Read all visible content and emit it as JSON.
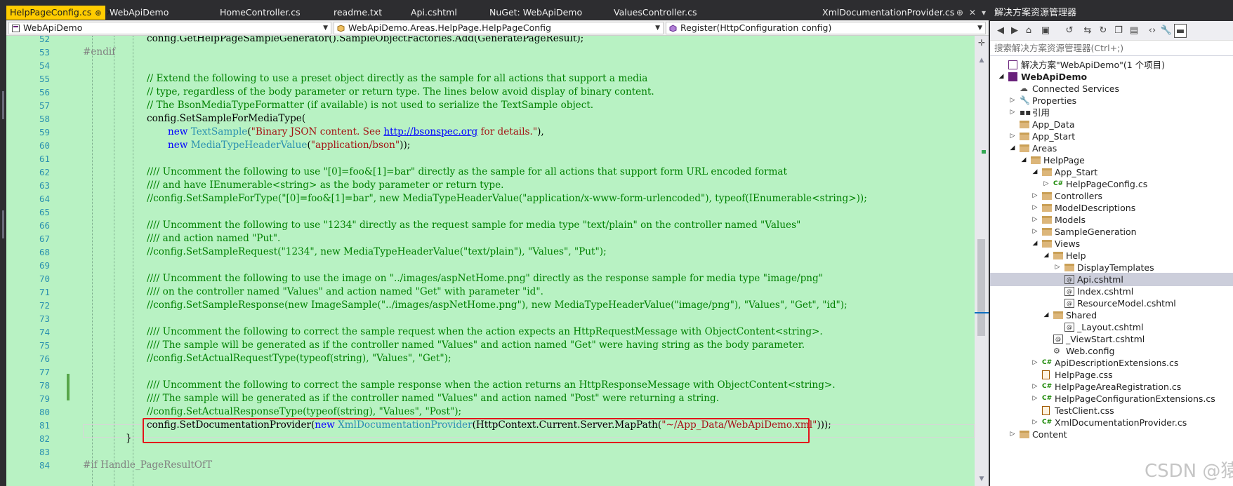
{
  "tabs": [
    {
      "label": "HelpPageConfig.cs",
      "active": true,
      "pin": "⊕",
      "close": "✕"
    },
    {
      "label": "WebApiDemo"
    },
    {
      "label": "HomeController.cs"
    },
    {
      "label": "readme.txt"
    },
    {
      "label": "Api.cshtml"
    },
    {
      "label": "NuGet: WebApiDemo"
    },
    {
      "label": "ValuesController.cs"
    },
    {
      "label": "XmlDocumentationProvider.cs"
    }
  ],
  "tab_bar_icons": {
    "pin": "⊕",
    "close": "✕",
    "menu": "▾"
  },
  "nav": {
    "project": "WebApiDemo",
    "type": "WebApiDemo.Areas.HelpPage.HelpPageConfig",
    "member": "Register(HttpConfiguration config)"
  },
  "line_numbers": [
    "52",
    "53",
    "54",
    "55",
    "56",
    "57",
    "58",
    "59",
    "60",
    "61",
    "62",
    "63",
    "64",
    "65",
    "66",
    "67",
    "68",
    "69",
    "70",
    "71",
    "72",
    "73",
    "74",
    "75",
    "76",
    "77",
    "78",
    "79",
    "80",
    "81",
    "82",
    "83",
    "84"
  ],
  "code": {
    "l52": "config.GetHelpPageSampleGenerator().SampleObjectFactories.Add(GeneratePageResult);",
    "l53": "#endif",
    "l55": "// Extend the following to use a preset object directly as the sample for all actions that support a media",
    "l56": "// type, regardless of the body parameter or return type. The lines below avoid display of binary content.",
    "l57": "// The BsonMediaTypeFormatter (if available) is not used to serialize the TextSample object.",
    "l58": "config.SetSampleForMediaType(",
    "l59_kw": "new",
    "l59_ty": "TextSample",
    "l59_p": "(",
    "l59_s1": "\"Binary JSON content. See ",
    "l59_link": "http://bsonspec.org",
    "l59_s2": " for details.\"",
    "l59_e": "),",
    "l60_kw": "new",
    "l60_ty": "MediaTypeHeaderValue",
    "l60_p": "(",
    "l60_s": "\"application/bson\"",
    "l60_e": "));",
    "l62": "//// Uncomment the following to use \"[0]=foo&[1]=bar\" directly as the sample for all actions that support form URL encoded format",
    "l63": "//// and have IEnumerable<string> as the body parameter or return type.",
    "l64": "//config.SetSampleForType(\"[0]=foo&[1]=bar\", new MediaTypeHeaderValue(\"application/x-www-form-urlencoded\"), typeof(IEnumerable<string>));",
    "l66": "//// Uncomment the following to use \"1234\" directly as the request sample for media type \"text/plain\" on the controller named \"Values\"",
    "l67": "//// and action named \"Put\".",
    "l68": "//config.SetSampleRequest(\"1234\", new MediaTypeHeaderValue(\"text/plain\"), \"Values\", \"Put\");",
    "l70": "//// Uncomment the following to use the image on \"../images/aspNetHome.png\" directly as the response sample for media type \"image/png\"",
    "l71": "//// on the controller named \"Values\" and action named \"Get\" with parameter \"id\".",
    "l72": "//config.SetSampleResponse(new ImageSample(\"../images/aspNetHome.png\"), new MediaTypeHeaderValue(\"image/png\"), \"Values\", \"Get\", \"id\");",
    "l74": "//// Uncomment the following to correct the sample request when the action expects an HttpRequestMessage with ObjectContent<string>.",
    "l75": "//// The sample will be generated as if the controller named \"Values\" and action named \"Get\" were having string as the body parameter.",
    "l76": "//config.SetActualRequestType(typeof(string), \"Values\", \"Get\");",
    "l78": "//// Uncomment the following to correct the sample response when the action returns an HttpResponseMessage with ObjectContent<string>.",
    "l79": "//// The sample will be generated as if the controller named \"Values\" and action named \"Post\" were returning a string.",
    "l80": "//config.SetActualResponseType(typeof(string), \"Values\", \"Post\");",
    "l81_a": "config.SetDocumentationProvider(",
    "l81_kw": "new",
    "l81_ty": "XmlDocumentationProvider",
    "l81_b": "(HttpContext.Current.Server.MapPath(",
    "l81_s": "\"~/App_Data/WebApiDemo.xml\"",
    "l81_e": ")));",
    "l82": "}",
    "l84": "#if Handle_PageResultOfT"
  },
  "solution_explorer": {
    "title": "解决方案资源管理器",
    "search_placeholder": "搜索解决方案资源管理器(Ctrl+;)",
    "toolbar_icons": [
      "◀",
      "▶",
      "⌂",
      "▣",
      "↺",
      "⇆",
      "↻",
      "❐",
      "▤",
      "‹›",
      "🔧",
      "▬"
    ],
    "nodes": [
      {
        "label": "解决方案\"WebApiDemo\"(1 个项目)",
        "icon": "sol",
        "expander": "",
        "level": 0
      },
      {
        "label": "WebApiDemo",
        "icon": "proj",
        "expander": "◢",
        "level": 0,
        "bold": true
      },
      {
        "label": "Connected Services",
        "icon": "gear",
        "expander": "",
        "level": 1
      },
      {
        "label": "Properties",
        "icon": "wrench",
        "expander": "▷",
        "level": 1
      },
      {
        "label": "引用",
        "icon": "ref",
        "expander": "▷",
        "level": 1
      },
      {
        "label": "App_Data",
        "icon": "folder",
        "expander": "",
        "level": 1
      },
      {
        "label": "App_Start",
        "icon": "folder",
        "expander": "▷",
        "level": 1
      },
      {
        "label": "Areas",
        "icon": "folder",
        "expander": "◢",
        "level": 1
      },
      {
        "label": "HelpPage",
        "icon": "folder",
        "expander": "◢",
        "level": 2
      },
      {
        "label": "App_Start",
        "icon": "folder",
        "expander": "◢",
        "level": 3
      },
      {
        "label": "HelpPageConfig.cs",
        "icon": "cs",
        "expander": "▷",
        "level": 4
      },
      {
        "label": "Controllers",
        "icon": "folder",
        "expander": "▷",
        "level": 3
      },
      {
        "label": "ModelDescriptions",
        "icon": "folder",
        "expander": "▷",
        "level": 3
      },
      {
        "label": "Models",
        "icon": "folder",
        "expander": "▷",
        "level": 3
      },
      {
        "label": "SampleGeneration",
        "icon": "folder",
        "expander": "▷",
        "level": 3
      },
      {
        "label": "Views",
        "icon": "folder",
        "expander": "◢",
        "level": 3
      },
      {
        "label": "Help",
        "icon": "folder",
        "expander": "◢",
        "level": 4
      },
      {
        "label": "DisplayTemplates",
        "icon": "folder",
        "expander": "▷",
        "level": 5
      },
      {
        "label": "Api.cshtml",
        "icon": "cshtml",
        "expander": "",
        "level": 5,
        "selected": true
      },
      {
        "label": "Index.cshtml",
        "icon": "cshtml",
        "expander": "",
        "level": 5
      },
      {
        "label": "ResourceModel.cshtml",
        "icon": "cshtml",
        "expander": "",
        "level": 5
      },
      {
        "label": "Shared",
        "icon": "folder",
        "expander": "◢",
        "level": 4
      },
      {
        "label": "_Layout.cshtml",
        "icon": "cshtml",
        "expander": "",
        "level": 5
      },
      {
        "label": "_ViewStart.cshtml",
        "icon": "cshtml",
        "expander": "",
        "level": 4
      },
      {
        "label": "Web.config",
        "icon": "cfg",
        "expander": "",
        "level": 4
      },
      {
        "label": "ApiDescriptionExtensions.cs",
        "icon": "cs",
        "expander": "▷",
        "level": 3
      },
      {
        "label": "HelpPage.css",
        "icon": "css",
        "expander": "",
        "level": 3
      },
      {
        "label": "HelpPageAreaRegistration.cs",
        "icon": "cs",
        "expander": "▷",
        "level": 3
      },
      {
        "label": "HelpPageConfigurationExtensions.cs",
        "icon": "cs",
        "expander": "▷",
        "level": 3
      },
      {
        "label": "TestClient.css",
        "icon": "css",
        "expander": "",
        "level": 3
      },
      {
        "label": "XmlDocumentationProvider.cs",
        "icon": "cs",
        "expander": "▷",
        "level": 3
      },
      {
        "label": "Content",
        "icon": "folder",
        "expander": "▷",
        "level": 1
      }
    ]
  },
  "watermark": "CSDN @猿享天开",
  "colors": {
    "editor_bg": "#b8f2c3",
    "active_tab": "#ffcc00",
    "highlight_box": "#e3141b"
  }
}
